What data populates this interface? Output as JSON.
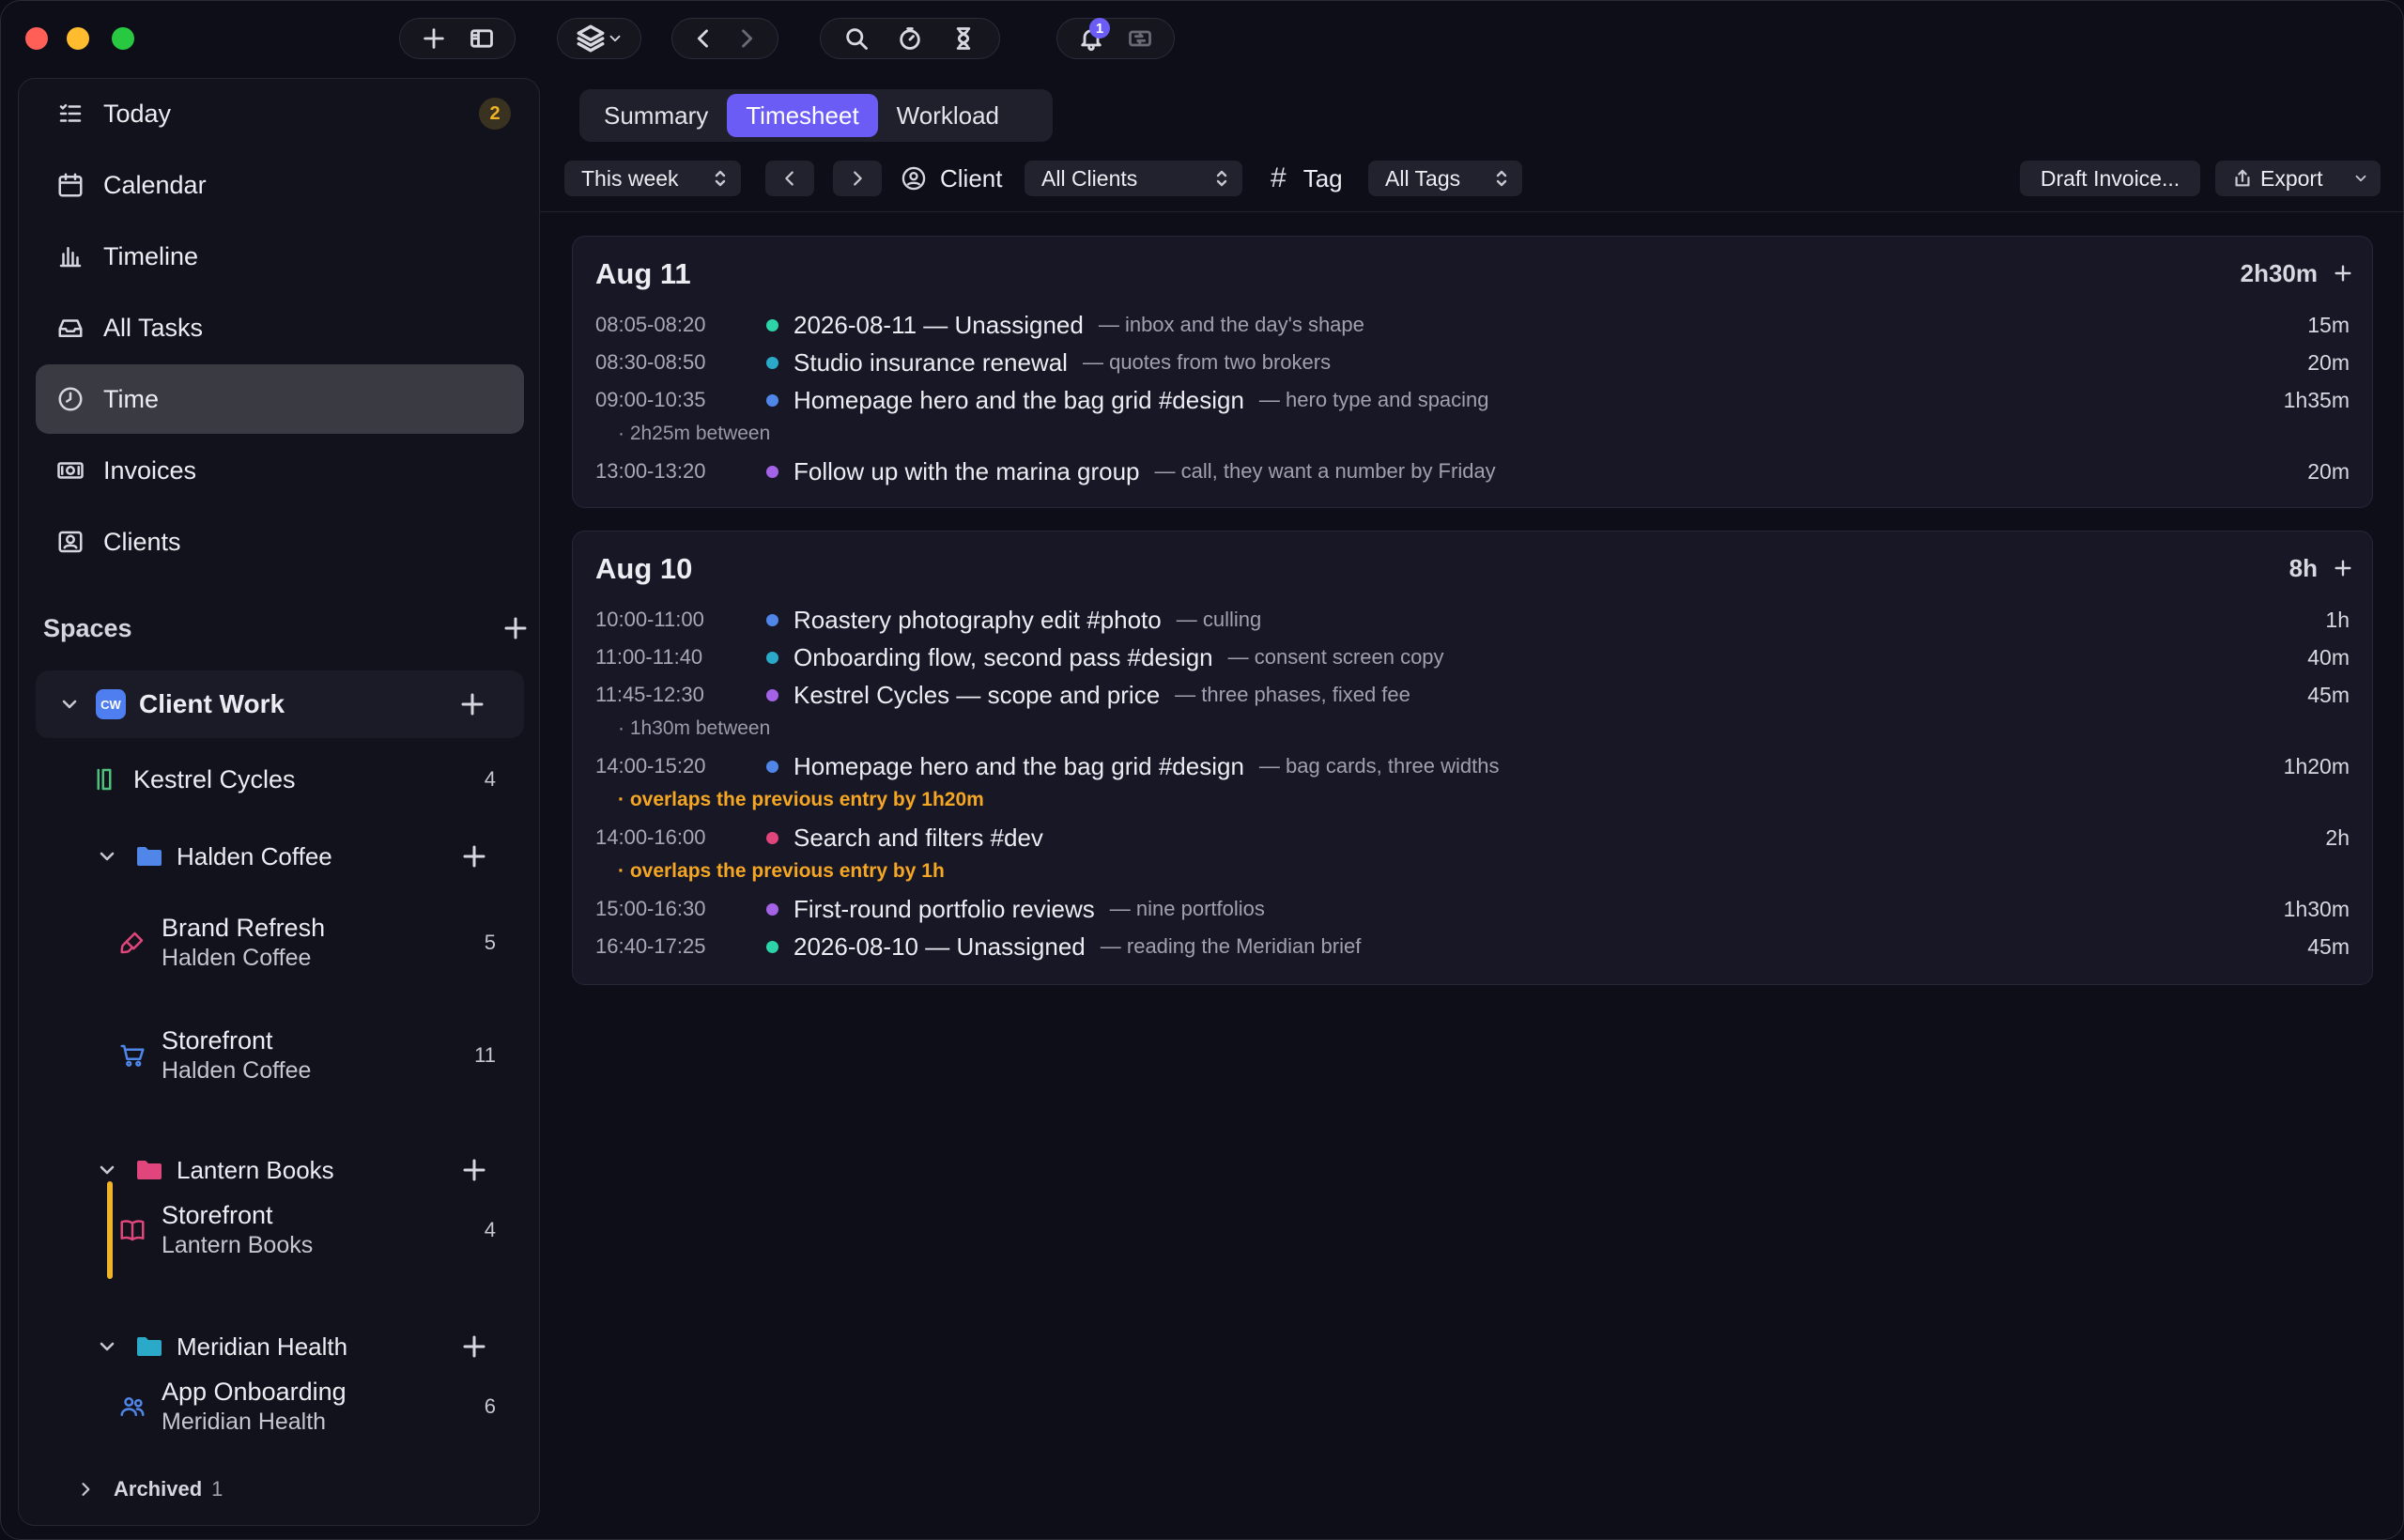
{
  "toolbar": {
    "notifications_count": "1"
  },
  "sidebar": {
    "nav": [
      {
        "label": "Today",
        "badge": "2"
      },
      {
        "label": "Calendar"
      },
      {
        "label": "Timeline"
      },
      {
        "label": "All Tasks"
      },
      {
        "label": "Time"
      },
      {
        "label": "Invoices"
      },
      {
        "label": "Clients"
      }
    ],
    "spaces_title": "Spaces",
    "space": {
      "badge": "CW",
      "name": "Client Work"
    },
    "tree": {
      "kestrel": {
        "label": "Kestrel Cycles",
        "count": "4"
      },
      "halden": {
        "label": "Halden Coffee"
      },
      "brand_refresh": {
        "label": "Brand Refresh",
        "sub": "Halden Coffee",
        "count": "5"
      },
      "storefront_halden": {
        "label": "Storefront",
        "sub": "Halden Coffee",
        "count": "11"
      },
      "lantern": {
        "label": "Lantern Books"
      },
      "storefront_lantern": {
        "label": "Storefront",
        "sub": "Lantern Books",
        "count": "4"
      },
      "meridian": {
        "label": "Meridian Health"
      },
      "app_onboarding": {
        "label": "App Onboarding",
        "sub": "Meridian Health",
        "count": "6"
      }
    },
    "archived": {
      "label": "Archived",
      "count": "1"
    }
  },
  "tabs": [
    "Summary",
    "Timesheet",
    "Workload"
  ],
  "filters": {
    "range": "This week",
    "client_label": "Client",
    "client_value": "All Clients",
    "tag_label": "Tag",
    "tag_value": "All Tags",
    "draft_invoice": "Draft Invoice...",
    "export": "Export"
  },
  "colors": {
    "accent": "#6b5cf6",
    "teal": "#2dd4a7",
    "cyan": "#2aa9c9",
    "blue": "#4f86e8",
    "purple": "#a463e6",
    "pink": "#e0457b",
    "warning": "#f5a623"
  },
  "days": [
    {
      "date": "Aug 11",
      "total": "2h30m",
      "entries": [
        {
          "time": "08:05-08:20",
          "title": "2026-08-11 — Unassigned",
          "note": "— inbox and the day's shape",
          "dur": "15m"
        },
        {
          "time": "08:30-08:50",
          "title": "Studio insurance renewal",
          "note": "— quotes from two brokers",
          "dur": "20m"
        },
        {
          "time": "09:00-10:35",
          "title": "Homepage hero and the bag grid #design",
          "note": "— hero type and spacing",
          "dur": "1h35m"
        },
        {
          "gap": "· 2h25m between"
        },
        {
          "time": "13:00-13:20",
          "title": "Follow up with the marina group",
          "note": "— call, they want a number by Friday",
          "dur": "20m"
        }
      ]
    },
    {
      "date": "Aug 10",
      "total": "8h",
      "entries": [
        {
          "time": "10:00-11:00",
          "title": "Roastery photography edit #photo",
          "note": "— culling",
          "dur": "1h"
        },
        {
          "time": "11:00-11:40",
          "title": "Onboarding flow, second pass #design",
          "note": "— consent screen copy",
          "dur": "40m"
        },
        {
          "time": "11:45-12:30",
          "title": "Kestrel Cycles — scope and price",
          "note": "— three phases, fixed fee",
          "dur": "45m"
        },
        {
          "gap": "· 1h30m between"
        },
        {
          "time": "14:00-15:20",
          "title": "Homepage hero and the bag grid #design",
          "note": "— bag cards, three widths",
          "dur": "1h20m"
        },
        {
          "warn": "· overlaps the previous entry by 1h20m"
        },
        {
          "time": "14:00-16:00",
          "title": "Search and filters #dev",
          "note": "",
          "dur": "2h"
        },
        {
          "warn": "· overlaps the previous entry by 1h"
        },
        {
          "time": "15:00-16:30",
          "title": "First-round portfolio reviews",
          "note": "— nine portfolios",
          "dur": "1h30m"
        },
        {
          "time": "16:40-17:25",
          "title": "2026-08-10 — Unassigned",
          "note": "— reading the Meridian brief",
          "dur": "45m"
        }
      ]
    }
  ]
}
